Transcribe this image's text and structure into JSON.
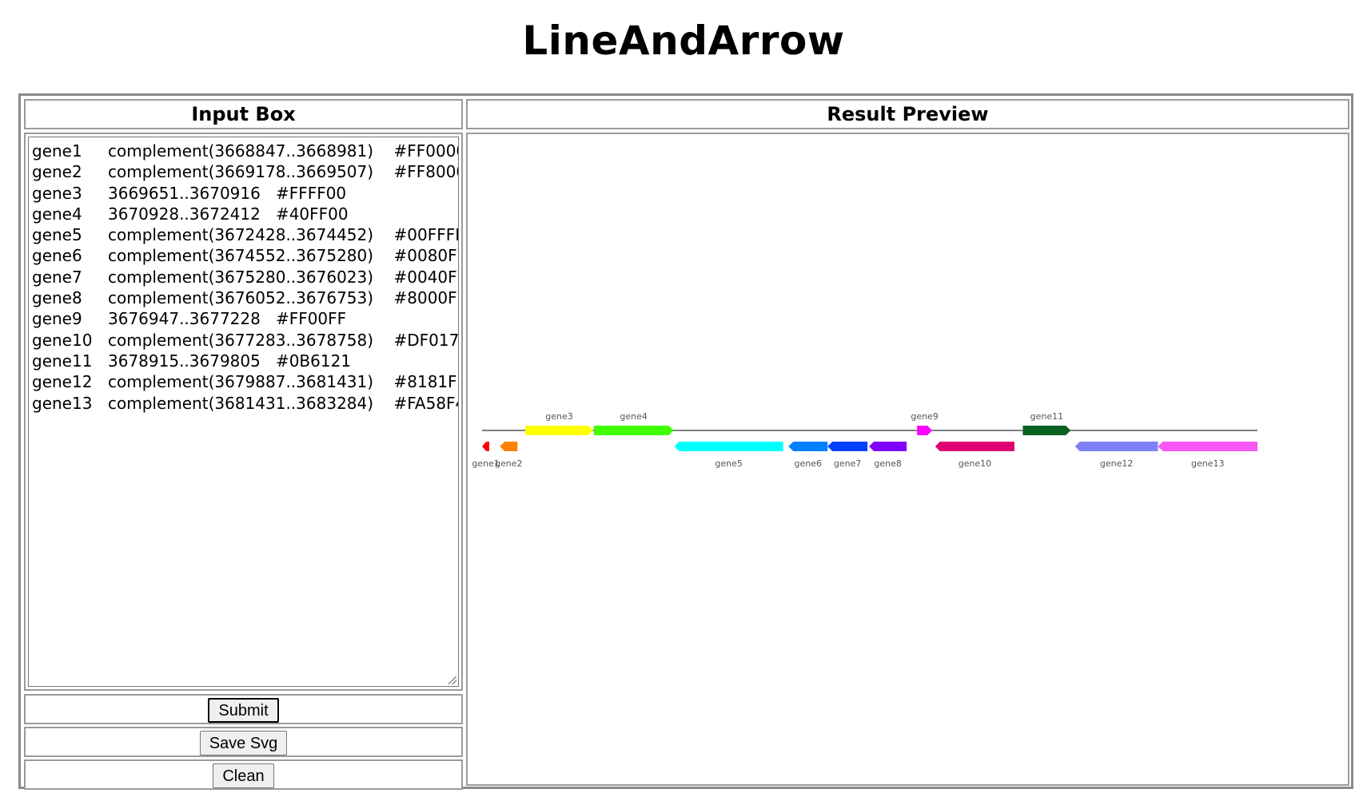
{
  "page": {
    "title": "LineAndArrow"
  },
  "input_panel": {
    "header": "Input Box",
    "lines": [
      {
        "name": "gene1",
        "loc": "complement(3668847..3668981)",
        "color": "#FF0000"
      },
      {
        "name": "gene2",
        "loc": "complement(3669178..3669507)",
        "color": "#FF8000"
      },
      {
        "name": "gene3",
        "loc": "3669651..3670916",
        "color": "#FFFF00"
      },
      {
        "name": "gene4",
        "loc": "3670928..3672412",
        "color": "#40FF00"
      },
      {
        "name": "gene5",
        "loc": "complement(3672428..3674452)",
        "color": "#00FFFF"
      },
      {
        "name": "gene6",
        "loc": "complement(3674552..3675280)",
        "color": "#0080FF"
      },
      {
        "name": "gene7",
        "loc": "complement(3675280..3676023)",
        "color": "#0040FF"
      },
      {
        "name": "gene8",
        "loc": "complement(3676052..3676753)",
        "color": "#8000FF"
      },
      {
        "name": "gene9",
        "loc": "3676947..3677228",
        "color": "#FF00FF"
      },
      {
        "name": "gene10",
        "loc": "complement(3677283..3678758)",
        "color": "#DF0174"
      },
      {
        "name": "gene11",
        "loc": "3678915..3679805",
        "color": "#0B6121"
      },
      {
        "name": "gene12",
        "loc": "complement(3679887..3681431)",
        "color": "#8181F7"
      },
      {
        "name": "gene13",
        "loc": "complement(3681431..3683284)",
        "color": "#FA58F4"
      }
    ]
  },
  "buttons": {
    "submit": "Submit",
    "save_svg": "Save Svg",
    "clean": "Clean"
  },
  "preview_panel": {
    "header": "Result Preview",
    "genes": [
      {
        "name": "gene1",
        "start": 3668847,
        "end": 3668981,
        "strand": "-",
        "color": "#FF0000",
        "label": "gene1"
      },
      {
        "name": "gene2",
        "start": 3669178,
        "end": 3669507,
        "strand": "-",
        "color": "#FF8000",
        "label": "gene2"
      },
      {
        "name": "gene3",
        "start": 3669651,
        "end": 3670916,
        "strand": "+",
        "color": "#FFFF00",
        "label": "gene3"
      },
      {
        "name": "gene4",
        "start": 3670928,
        "end": 3672412,
        "strand": "+",
        "color": "#40FF00",
        "label": "gene4"
      },
      {
        "name": "gene5",
        "start": 3672428,
        "end": 3674452,
        "strand": "-",
        "color": "#00FFFF",
        "label": "gene5"
      },
      {
        "name": "gene6",
        "start": 3674552,
        "end": 3675280,
        "strand": "-",
        "color": "#0080FF",
        "label": "gene6"
      },
      {
        "name": "gene7",
        "start": 3675280,
        "end": 3676023,
        "strand": "-",
        "color": "#0040FF",
        "label": "gene7"
      },
      {
        "name": "gene8",
        "start": 3676052,
        "end": 3676753,
        "strand": "-",
        "color": "#8000FF",
        "label": "gene8"
      },
      {
        "name": "gene9",
        "start": 3676947,
        "end": 3677228,
        "strand": "+",
        "color": "#FF00FF",
        "label": "gene9"
      },
      {
        "name": "gene10",
        "start": 3677283,
        "end": 3678758,
        "strand": "-",
        "color": "#DF0174",
        "label": "gene10"
      },
      {
        "name": "gene11",
        "start": 3678915,
        "end": 3679805,
        "strand": "+",
        "color": "#0B6121",
        "label": "gene11"
      },
      {
        "name": "gene12",
        "start": 3679887,
        "end": 3681431,
        "strand": "-",
        "color": "#8181F7",
        "label": "gene12"
      },
      {
        "name": "gene13",
        "start": 3681431,
        "end": 3683284,
        "strand": "-",
        "color": "#FA58F4",
        "label": "gene13"
      }
    ],
    "axis_color": "#808080",
    "label_color": "#555555"
  }
}
